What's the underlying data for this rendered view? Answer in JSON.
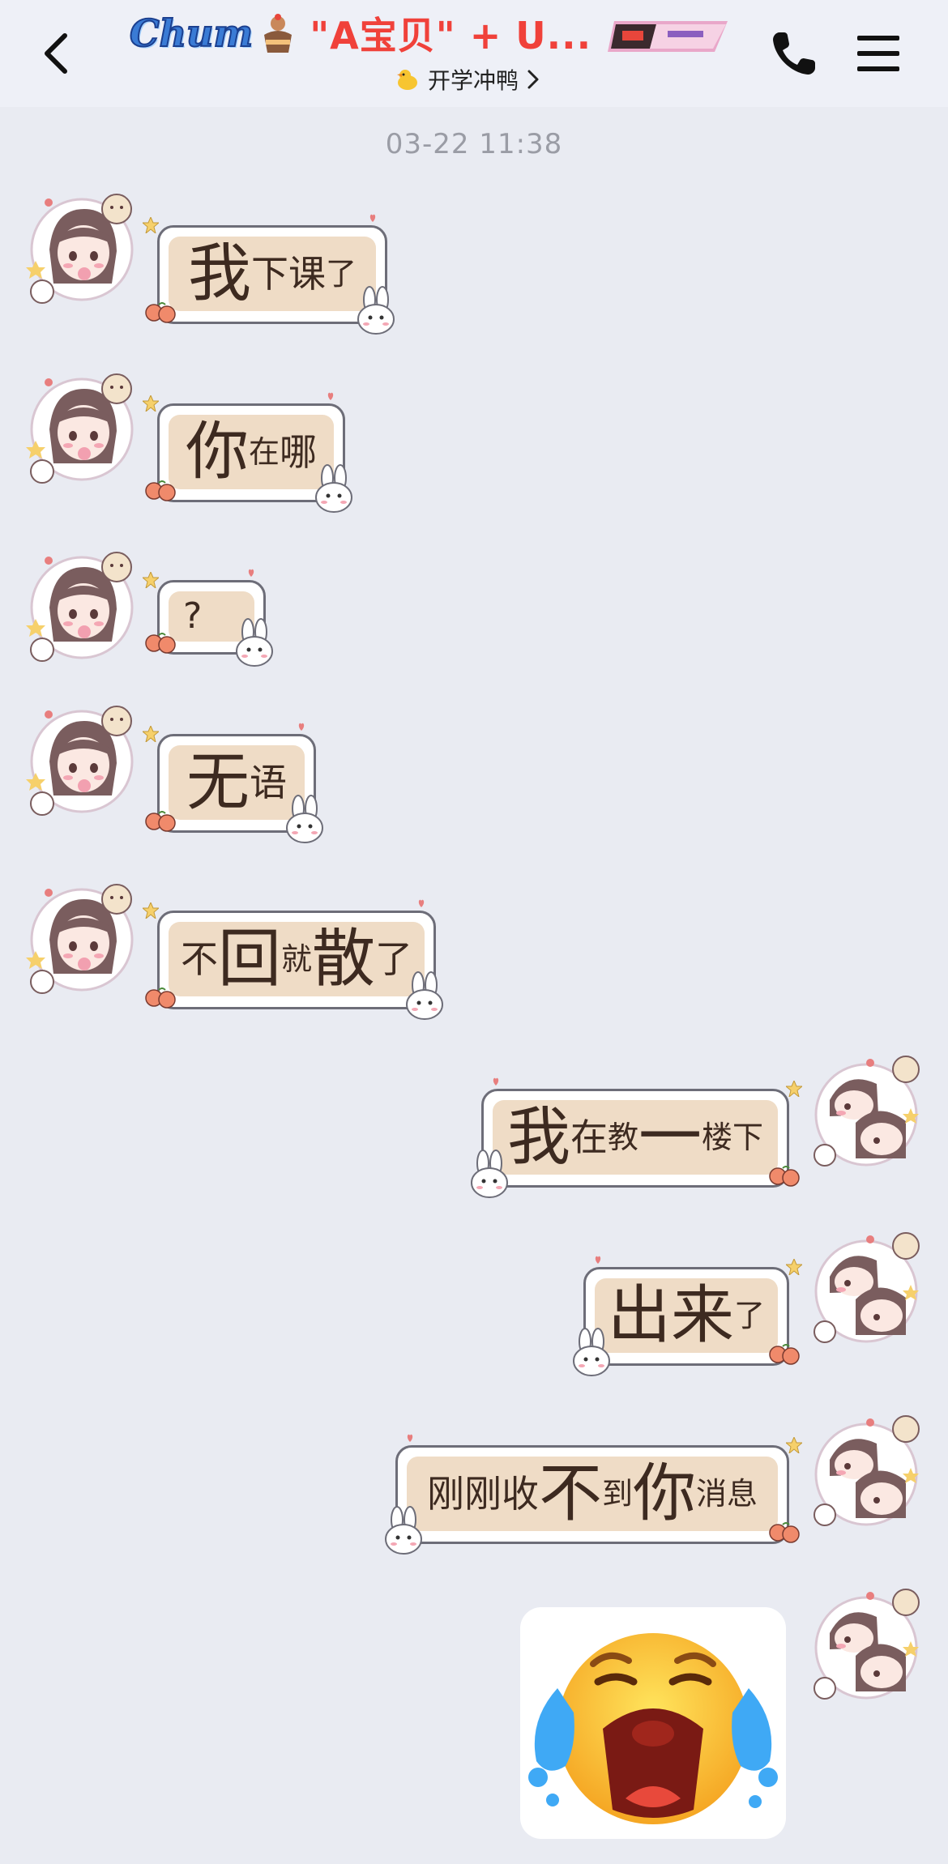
{
  "header": {
    "badge_left": "Chum",
    "title": "\"A宝贝\" + U...",
    "subtitle": "开学冲鸭",
    "icons": {
      "back": "chevron-left-icon",
      "subtitle_duck": "duck-emoji-icon",
      "subtitle_chevron": "chevron-right-icon",
      "call": "phone-icon",
      "menu": "hamburger-menu-icon"
    }
  },
  "timestamp": "03-22 11:38",
  "messages": [
    {
      "side": "left",
      "segments": [
        "我",
        "下",
        "课",
        "了"
      ]
    },
    {
      "side": "left",
      "segments": [
        "你",
        "在",
        "哪"
      ]
    },
    {
      "side": "left",
      "segments": [
        "?"
      ]
    },
    {
      "side": "left",
      "segments": [
        "无",
        "语"
      ]
    },
    {
      "side": "left",
      "segments": [
        "不",
        "回",
        "就",
        "散",
        "了"
      ]
    },
    {
      "side": "right",
      "segments": [
        "我",
        "在",
        "教",
        "一",
        "楼下"
      ]
    },
    {
      "side": "right",
      "segments": [
        "出",
        "来",
        "了"
      ]
    },
    {
      "side": "right",
      "segments": [
        "刚刚",
        "收",
        "不",
        "到",
        "你",
        "消息"
      ]
    }
  ],
  "sticker": {
    "name": "crying-face-emoji"
  },
  "colors": {
    "background": "#e9ebf2",
    "header_bg": "#eef0f7",
    "title_red": "#f0413a",
    "bubble_fill": "#efdcc6",
    "bubble_text": "#3d2a20",
    "timestamp": "#9a9ca5"
  }
}
